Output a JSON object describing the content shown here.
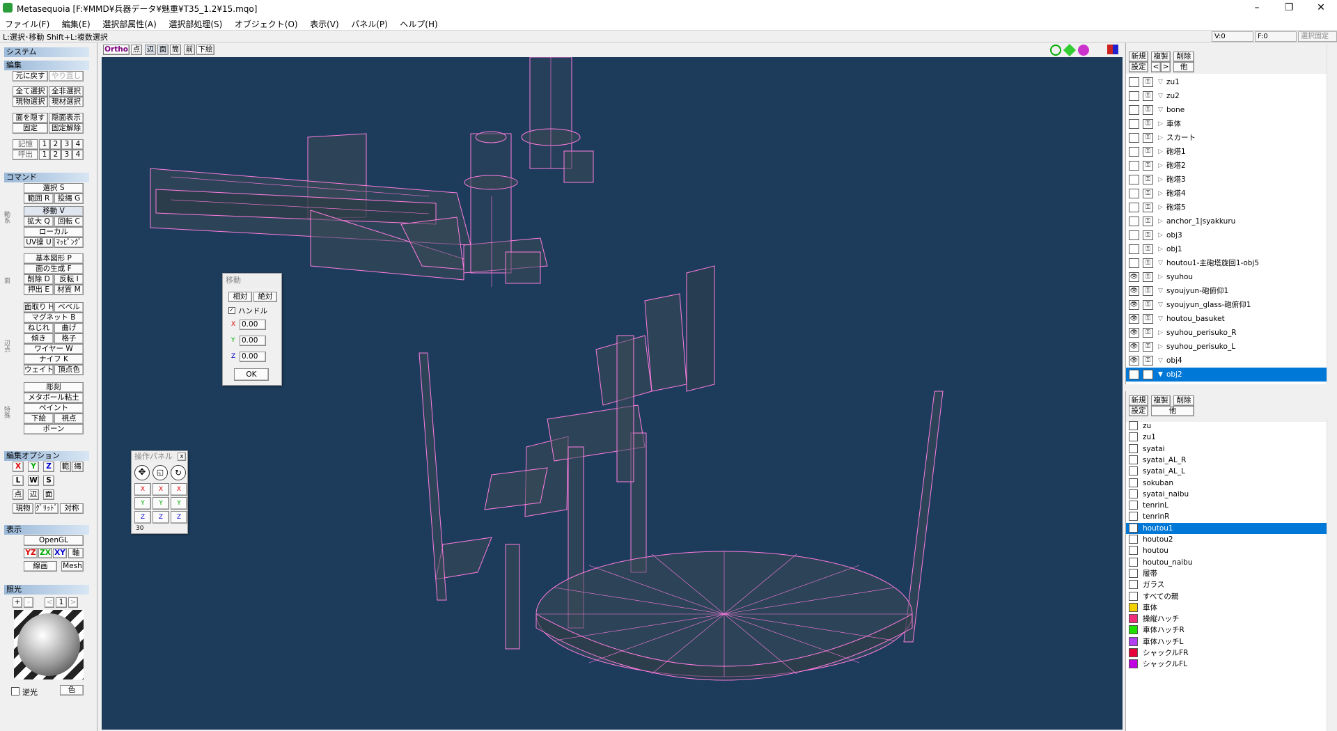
{
  "window": {
    "title": "Metasequoia [F:¥MMD¥兵器データ¥魅重¥T35_1.2¥15.mqo]",
    "min": "–",
    "max": "❐",
    "close": "✕"
  },
  "menu": [
    "ファイル(F)",
    "編集(E)",
    "選択部属性(A)",
    "選択部処理(S)",
    "オブジェクト(O)",
    "表示(V)",
    "パネル(P)",
    "ヘルプ(H)"
  ],
  "status": {
    "hint": "L:選択･移動 Shift+L:複数選択",
    "v": "V:0",
    "f": "F:0",
    "right": "選択固定"
  },
  "left": {
    "system": "システム",
    "edit": "編集",
    "undo": "元に戻す",
    "redo": "やり直し",
    "select_all": "全て選択",
    "deselect_all": "全非選択",
    "sel_obj": "現物選択",
    "sel_mat": "現材選択",
    "hide_face": "面を隠す",
    "show_hidden": "隠面表示",
    "fix": "固定",
    "unfix": "固定解除",
    "memory": "記憶",
    "recall": "呼出",
    "nums": [
      "1",
      "2",
      "3",
      "4"
    ],
    "command": "コマンド",
    "select": "選択 S",
    "range": "範囲 R",
    "lasso": "投縄 G",
    "move": "移動 V",
    "scale": "拡大 Q",
    "rotate": "回転 C",
    "local": "ローカル",
    "uv": "UV操 U",
    "mapping": "ﾏｯﾋﾟﾝｸﾞ",
    "basic": "基本図形 P",
    "face_gen": "面の生成 F",
    "delete": "削除 D",
    "flip": "反転 I",
    "extrude": "押出 E",
    "material": "材質 M",
    "chamfer": "面取り H",
    "bevel": "ベベル",
    "magnet": "マグネット B",
    "twist": "ねじれ",
    "bend": "曲げ",
    "tilt": "傾き",
    "lattice": "格子",
    "wire": "ワイヤー W",
    "knife": "ナイフ K",
    "weight": "ウェイト",
    "vcolor": "頂点色",
    "carve": "彫刻",
    "metaball": "メタボール粘土",
    "paint": "ペイント",
    "underlay": "下絵",
    "viewpoint": "視点",
    "bone": "ボーン",
    "vert_labels": [
      "動",
      "系",
      "回",
      "面",
      "辺",
      "点",
      "特",
      "殊"
    ],
    "editopt": "編集オプション",
    "x": "X",
    "y": "Y",
    "z": "Z",
    "range2": "範",
    "lasso2": "縄",
    "l": "L",
    "w": "W",
    "s": "S",
    "pt": "点",
    "edge": "辺",
    "face": "面",
    "cur_obj": "現物",
    "grid": "ｸﾞﾘｯﾄﾞ",
    "sym": "対称",
    "display": "表示",
    "opengl": "OpenGL",
    "yz": "YZ",
    "zx": "ZX",
    "xy": "XY",
    "axis": "軸",
    "wire2": "線画",
    "mesh": "Mesh",
    "light": "照光",
    "plus": "+",
    "minus": "-",
    "lt": "<",
    "gt": ">",
    "one": "1",
    "backlight": "逆光",
    "color": "色"
  },
  "view": {
    "mode": "Ortho",
    "buttons": [
      "点",
      "辺",
      "面",
      "筒",
      "前",
      "下絵"
    ]
  },
  "move_dlg": {
    "title": "移動",
    "rel": "相対",
    "abs": "絶対",
    "handle": "ハンドル",
    "x_label": "X",
    "y_label": "Y",
    "z_label": "Z",
    "x": "0.00",
    "y": "0.00",
    "z": "0.00",
    "ok": "OK"
  },
  "op_panel": {
    "title": "操作パネル",
    "close": "x",
    "value": "30",
    "x": "X",
    "y": "Y",
    "z": "Z"
  },
  "objects": {
    "new": "新規",
    "copy": "複製",
    "del": "削除",
    "settings": "設定",
    "prev": "<",
    "next": ">",
    "other": "他",
    "items": [
      {
        "name": "zu1",
        "eye": false,
        "tri": "▽"
      },
      {
        "name": "zu2",
        "eye": false,
        "tri": "▽"
      },
      {
        "name": "bone",
        "eye": false,
        "tri": "▽"
      },
      {
        "name": "車体",
        "eye": false,
        "tri": "▷"
      },
      {
        "name": "スカート",
        "eye": false,
        "tri": "▷"
      },
      {
        "name": "砲塔1",
        "eye": false,
        "tri": "▷"
      },
      {
        "name": "砲塔2",
        "eye": false,
        "tri": "▷"
      },
      {
        "name": "砲塔3",
        "eye": false,
        "tri": "▷"
      },
      {
        "name": "砲塔4",
        "eye": false,
        "tri": "▷"
      },
      {
        "name": "砲塔5",
        "eye": false,
        "tri": "▷"
      },
      {
        "name": "anchor_1|syakkuru",
        "eye": false,
        "tri": "▷"
      },
      {
        "name": "obj3",
        "eye": false,
        "tri": "▷"
      },
      {
        "name": "obj1",
        "eye": false,
        "tri": "▷"
      },
      {
        "name": "houtou1-主砲塔旋回1-obj5",
        "eye": false,
        "tri": "▽"
      },
      {
        "name": "syuhou",
        "eye": true,
        "tri": "▷"
      },
      {
        "name": "syoujyun-砲俯仰1",
        "eye": true,
        "tri": "▽"
      },
      {
        "name": "syoujyun_glass-砲俯仰1",
        "eye": true,
        "tri": "▽"
      },
      {
        "name": "houtou_basuket",
        "eye": true,
        "tri": "▽"
      },
      {
        "name": "syuhou_perisuko_R",
        "eye": true,
        "tri": "▷"
      },
      {
        "name": "syuhou_perisuko_L",
        "eye": true,
        "tri": "▷"
      },
      {
        "name": "obj4",
        "eye": true,
        "tri": "▽"
      },
      {
        "name": "obj2",
        "eye": true,
        "tri": "▼",
        "selected": true
      }
    ]
  },
  "materials": {
    "new": "新規",
    "copy": "複製",
    "del": "削除",
    "settings": "設定",
    "other": "他",
    "items": [
      {
        "name": "zu",
        "color": "#ffffff"
      },
      {
        "name": "zu1",
        "color": "#ffffff"
      },
      {
        "name": "syatai",
        "color": "#ffffff"
      },
      {
        "name": "syatai_AL_R",
        "color": "#ffffff"
      },
      {
        "name": "syatai_AL_L",
        "color": "#ffffff"
      },
      {
        "name": "sokuban",
        "color": "#ffffff"
      },
      {
        "name": "syatai_naibu",
        "color": "#ffffff"
      },
      {
        "name": "tenrinL",
        "color": "#ffffff"
      },
      {
        "name": "tenrinR",
        "color": "#ffffff"
      },
      {
        "name": "houtou1",
        "color": "#ffffff",
        "selected": true
      },
      {
        "name": "houtou2",
        "color": "#ffffff"
      },
      {
        "name": "houtou",
        "color": "#ffffff"
      },
      {
        "name": "houtou_naibu",
        "color": "#ffffff"
      },
      {
        "name": "履帯",
        "color": "#ffffff"
      },
      {
        "name": "ガラス",
        "color": "#ffffff"
      },
      {
        "name": "すべての親",
        "color": "#ffffff"
      },
      {
        "name": "車体",
        "color": "#f5d000"
      },
      {
        "name": "操縦ハッチ",
        "color": "#ef2d7a"
      },
      {
        "name": "車体ハッチR",
        "color": "#1fe000"
      },
      {
        "name": "車体ハッチL",
        "color": "#b040f0"
      },
      {
        "name": "シャックルFR",
        "color": "#e8003a"
      },
      {
        "name": "シャックルFL",
        "color": "#c000e0"
      }
    ]
  },
  "colors": {
    "viewport": "#1d3c5c",
    "wire": "#ff7ce0",
    "selection": "#0078d7"
  }
}
